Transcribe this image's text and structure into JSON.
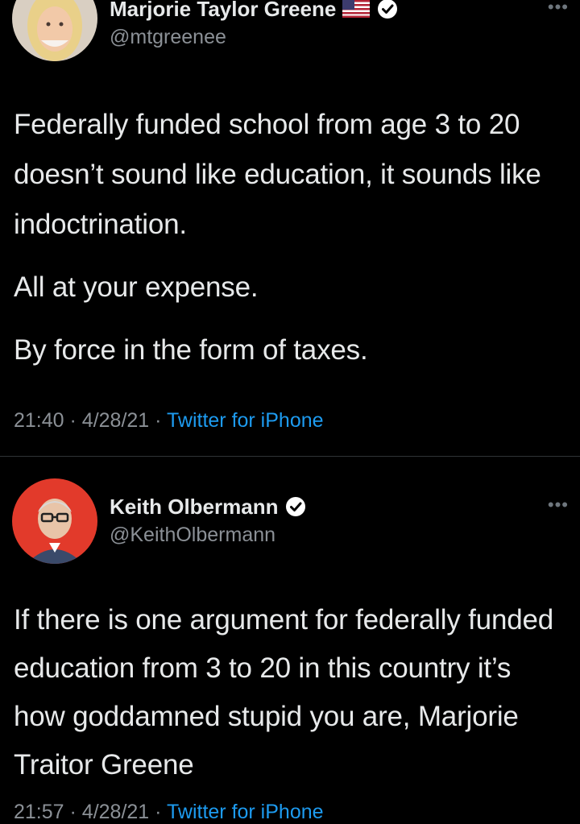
{
  "tweets": [
    {
      "display_name": "Marjorie Taylor Greene",
      "handle": "@mtgreenee",
      "body": [
        "Federally funded school from age 3 to 20 doesn’t sound like education, it sounds like indoctrination.",
        "All at your expense.",
        "By force in the form of taxes."
      ],
      "time": "21:40",
      "date": "4/28/21",
      "separator": "·",
      "source": "Twitter for iPhone",
      "icons": [
        "flag-icon",
        "verified-icon",
        "more-icon"
      ]
    },
    {
      "display_name": "Keith Olbermann",
      "handle": "@KeithOlbermann",
      "body": [
        "If there is one argument for federally funded education from 3 to 20 in this country it’s how goddamned stupid you are, Marjorie Traitor Greene"
      ],
      "time": "21:57",
      "date": "4/28/21",
      "separator": "·",
      "source": "Twitter for iPhone",
      "icons": [
        "verified-icon",
        "more-icon"
      ]
    }
  ],
  "colors": {
    "background": "#000000",
    "text_primary": "#e7e9ea",
    "text_secondary": "#8b9096",
    "link": "#1d9bf0",
    "divider": "#2f3336"
  }
}
